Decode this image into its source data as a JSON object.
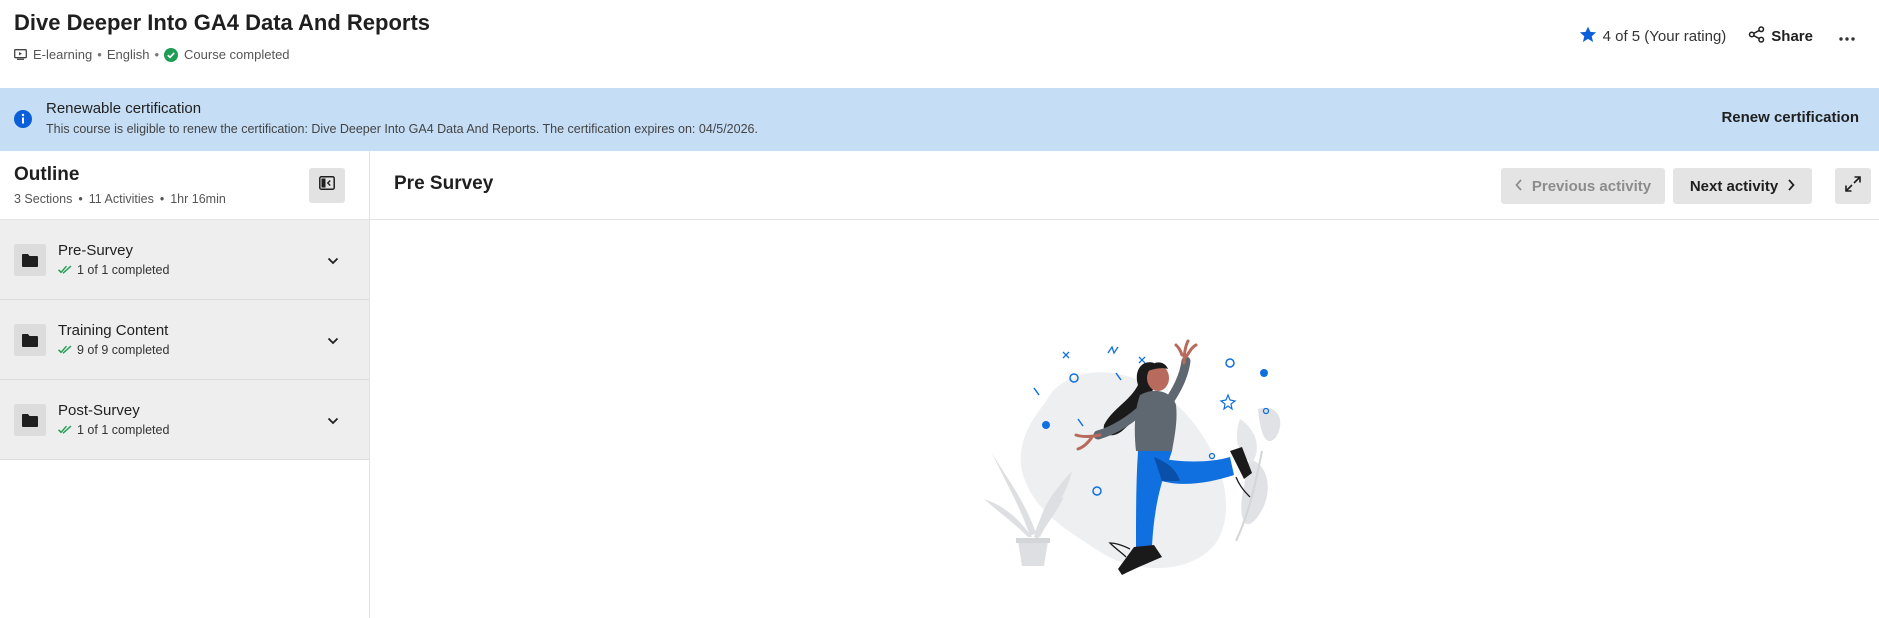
{
  "header": {
    "title": "Dive Deeper Into GA4 Data And Reports",
    "meta": {
      "type": "E-learning",
      "language": "English",
      "status": "Course completed"
    },
    "rating": "4 of 5 (Your rating)",
    "share_label": "Share"
  },
  "banner": {
    "title": "Renewable certification",
    "text": "This course is eligible to renew the certification: Dive Deeper Into GA4 Data And Reports. The certification expires on: 04/5/2026.",
    "action_label": "Renew certification"
  },
  "sidebar": {
    "title": "Outline",
    "meta": {
      "sections": "3 Sections",
      "activities": "11 Activities",
      "duration": "1hr 16min"
    },
    "sections": [
      {
        "title": "Pre-Survey",
        "status": "1 of 1 completed"
      },
      {
        "title": "Training Content",
        "status": "9 of 9 completed"
      },
      {
        "title": "Post-Survey",
        "status": "1 of 1 completed"
      }
    ]
  },
  "main": {
    "activity_title": "Pre Survey",
    "prev_label": "Previous activity",
    "next_label": "Next activity"
  },
  "colors": {
    "accent": "#0b5fd9",
    "banner_bg": "#c5ddf5",
    "success": "#1f9d55",
    "figure_blue": "#1070e0"
  }
}
